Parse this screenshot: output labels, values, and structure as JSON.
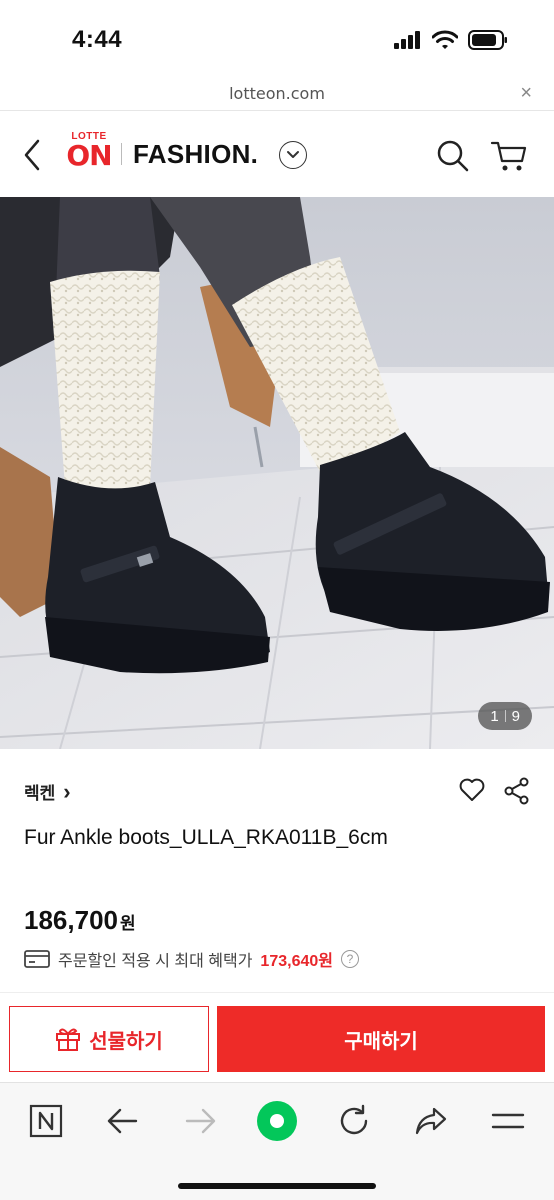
{
  "status_bar": {
    "time": "4:44"
  },
  "url_bar": {
    "url": "lotteon.com",
    "close": "×"
  },
  "header": {
    "logo_top": "LOTTE",
    "logo_main": "ON",
    "title": "FASHION",
    "title_dot": "."
  },
  "product": {
    "image_counter": {
      "current": "1",
      "total": "9"
    },
    "brand": "렉켄",
    "brand_chevron": "›",
    "name": "Fur Ankle boots_ULLA_RKA011B_6cm",
    "price": "186,700",
    "price_unit": "원",
    "benefit_label": "주문할인 적용 시 최대 혜택가",
    "benefit_amount": "173,640원",
    "help": "?"
  },
  "actions": {
    "gift_label": "선물하기",
    "buy_label": "구매하기"
  },
  "colors": {
    "brand_red": "#e8262b",
    "buy_red": "#ee2b28"
  }
}
